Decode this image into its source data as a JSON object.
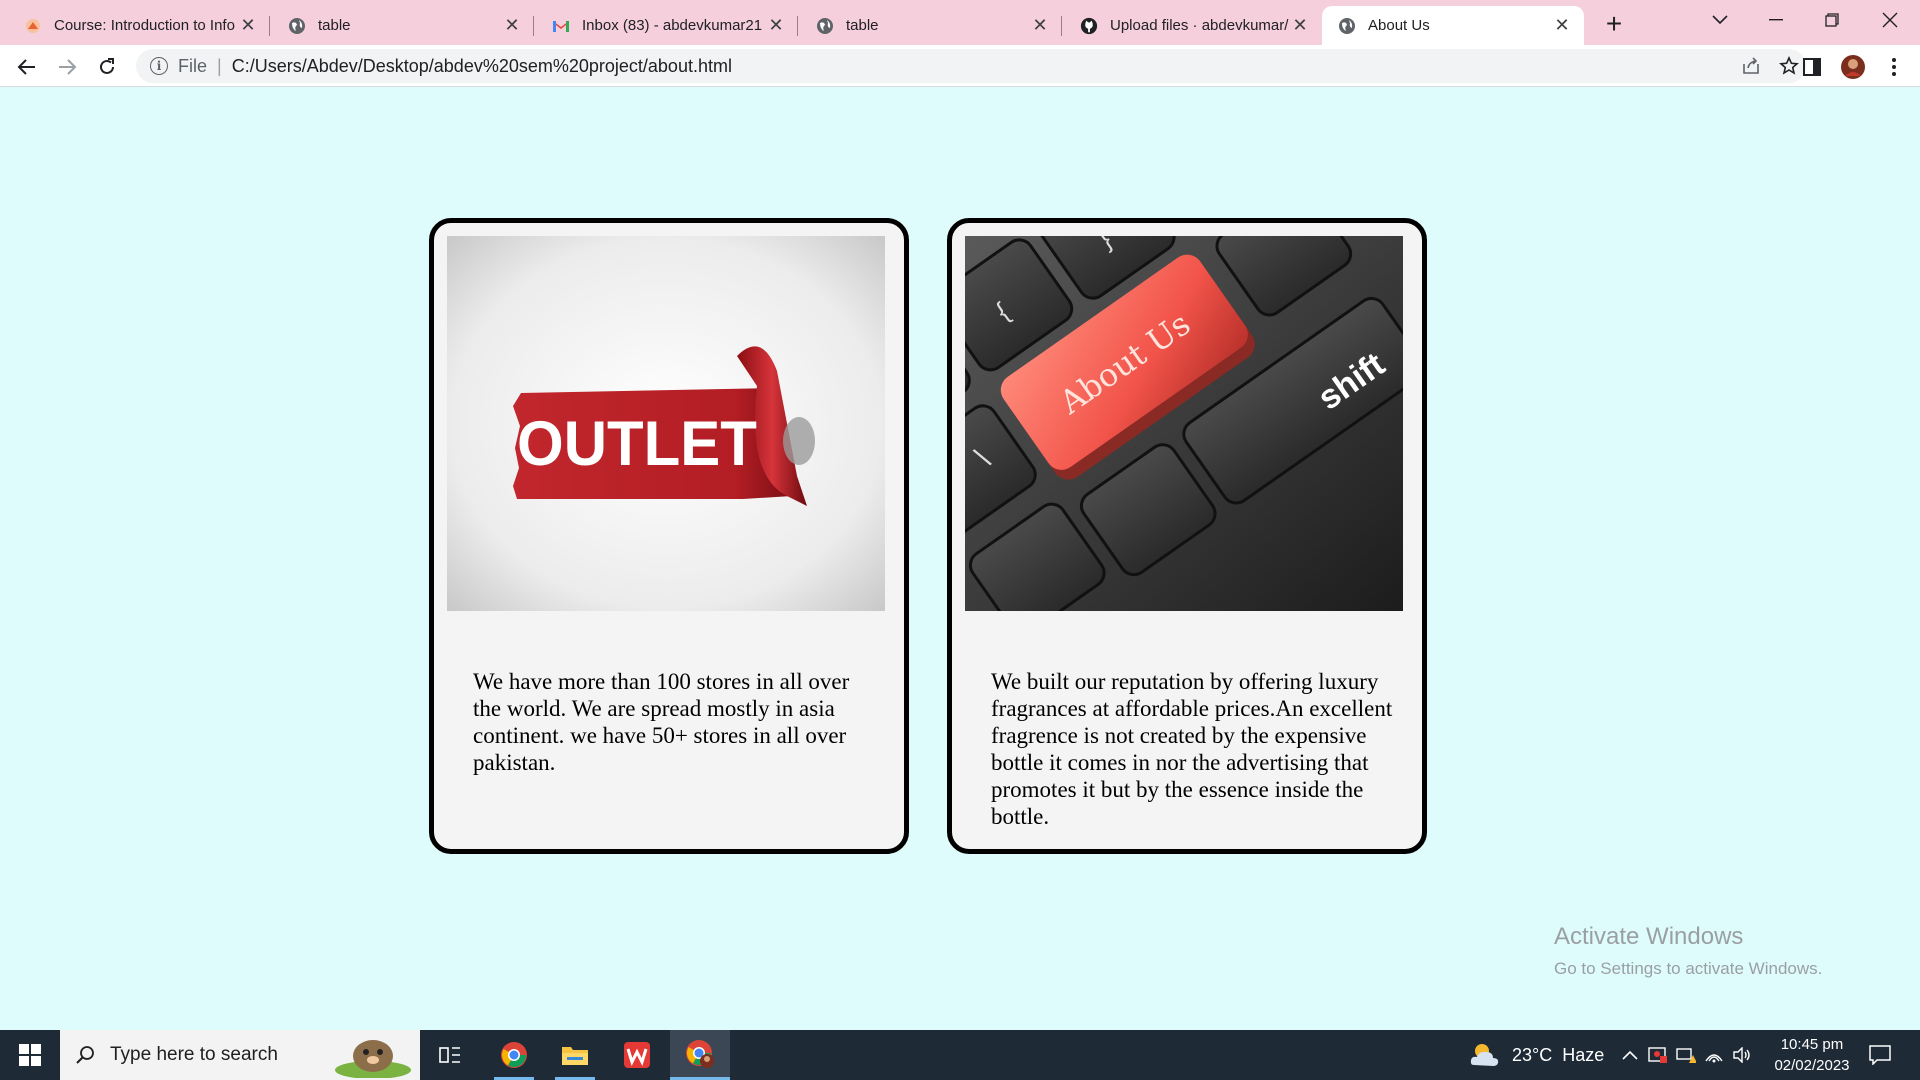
{
  "browser": {
    "tabs": [
      {
        "title": "Course: Introduction to Info",
        "icon": "moodle-icon"
      },
      {
        "title": "table",
        "icon": "globe-icon"
      },
      {
        "title": "Inbox (83) - abdevkumar21",
        "icon": "gmail-icon"
      },
      {
        "title": "table",
        "icon": "globe-icon"
      },
      {
        "title": "Upload files · abdevkumar/",
        "icon": "github-icon"
      },
      {
        "title": "About Us",
        "icon": "globe-icon",
        "active": true
      }
    ],
    "address": {
      "scheme_label": "File",
      "url": "C:/Users/Abdev/Desktop/abdev%20sem%20project/about.html"
    }
  },
  "page": {
    "cards": [
      {
        "image_alt": "outlet-banner-image",
        "image_text": "OUTLET",
        "text": "We have more than 100 stores in all over the world. We are spread mostly in asia continent. we have 50+ stores in all over pakistan."
      },
      {
        "image_alt": "about-us-keyboard-image",
        "image_text": "About Us",
        "key_label": "shift",
        "text": "We built our reputation by offering luxury fragrances at affordable prices.An excellent fragrence is not created by the expensive bottle it comes in nor the advertising that promotes it but by the essence inside the bottle."
      }
    ]
  },
  "watermark": {
    "line1": "Activate Windows",
    "line2": "Go to Settings to activate Windows."
  },
  "taskbar": {
    "search_placeholder": "Type here to search",
    "weather": {
      "temp": "23°C",
      "condition": "Haze"
    },
    "time": "10:45 pm",
    "date": "02/02/2023"
  },
  "colors": {
    "tab_strip": "#f6cfdd",
    "page_background": "#dffcfd",
    "card_background": "#f4f4f4",
    "taskbar": "#1e2a36"
  }
}
